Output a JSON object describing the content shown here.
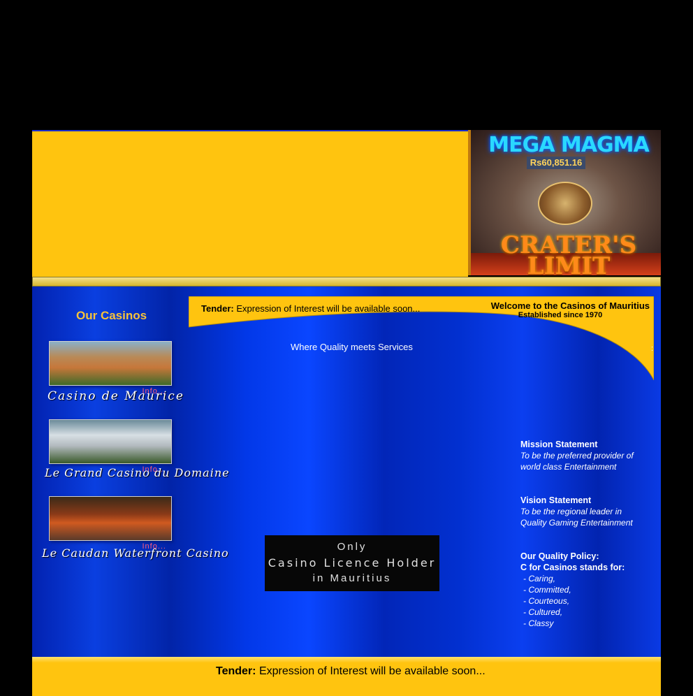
{
  "hero": {
    "title": "MEGA MAGMA",
    "jackpot": "Rs60,851.16",
    "subtitle": "CRATER'S LIMIT"
  },
  "sidebar": {
    "title": "Our Casinos",
    "casinos": [
      {
        "name": "Casino de Maurice",
        "info": "Info..."
      },
      {
        "name": "Le Grand Casino du Domaine",
        "info": "Info..."
      },
      {
        "name": "Le Caudan Waterfront Casino",
        "info": "Info..."
      }
    ]
  },
  "banner": {
    "tender_label": "Tender:",
    "tender_text": "Expression of Interest will be available soon...",
    "welcome": "Welcome to the Casinos of Mauritius",
    "established": "Established since 1970",
    "colon": ":"
  },
  "tagline": "Where Quality meets Services",
  "licence": {
    "line1": "Only",
    "line2": "Casino Licence Holder",
    "line3": "in Mauritius"
  },
  "statements": {
    "mission_title": "Mission Statement",
    "mission_text_1": "To be the preferred provider of",
    "mission_text_2": "world class Entertainment",
    "vision_title": "Vision Statement",
    "vision_text_1": "To be the regional leader in",
    "vision_text_2": "Quality Gaming Entertainment",
    "policy_title": "Our Quality Policy:",
    "policy_sub": "C for Casinos stands for:",
    "policy_items": [
      "- Caring,",
      "- Committed,",
      "- Courteous,",
      "- Cultured,",
      "- Classy"
    ]
  },
  "footer": {
    "tender_label": "Tender:",
    "tender_text": "Expression of Interest will be available soon..."
  },
  "colors": {
    "yellow": "#ffc40f",
    "blue": "#0a3fe0",
    "gold_text": "#f6c33a",
    "info_pink": "#ff5a7a"
  }
}
